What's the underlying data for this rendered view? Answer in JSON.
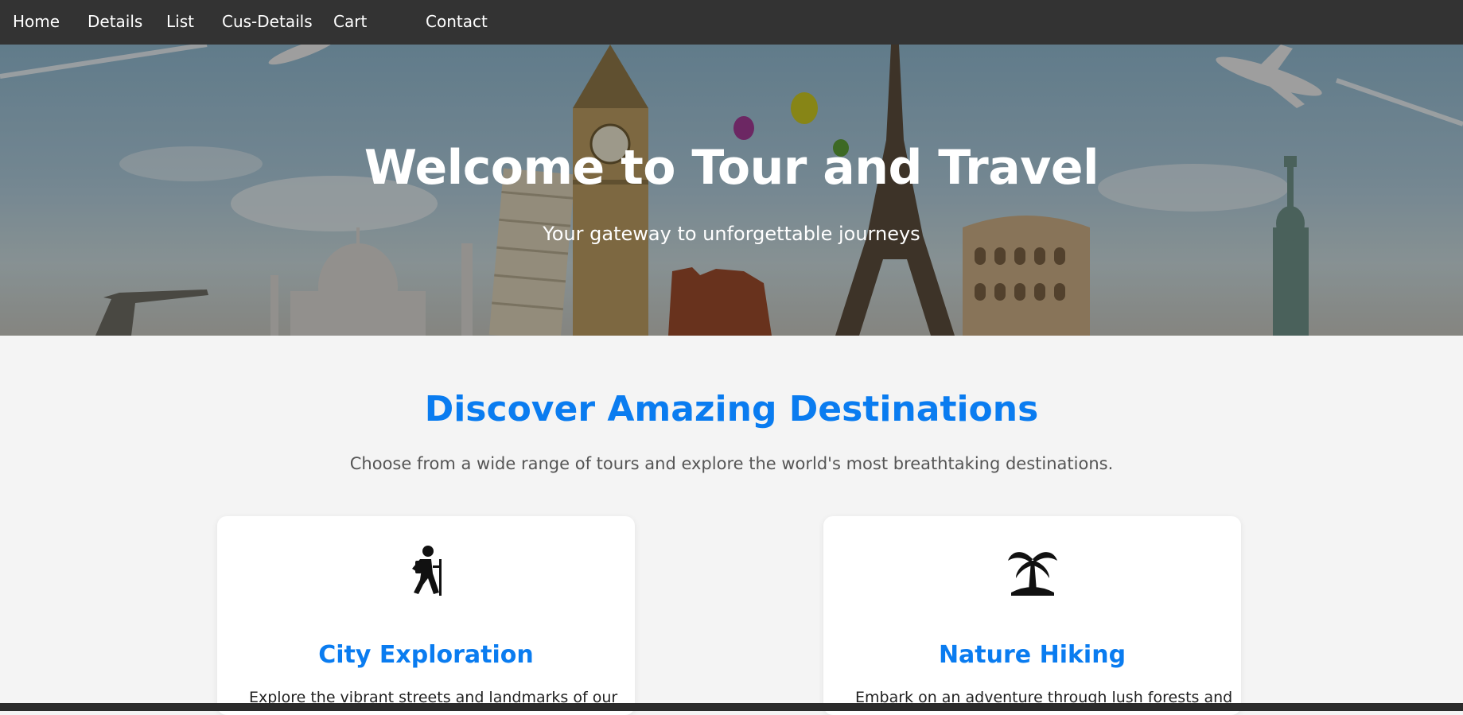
{
  "nav": {
    "items": [
      "Home",
      "Details",
      "List",
      "Cus-Details",
      "Cart",
      "Contact"
    ]
  },
  "hero": {
    "title": "Welcome to Tour and Travel",
    "subtitle": "Your gateway to unforgettable journeys"
  },
  "section": {
    "title": "Discover Amazing Destinations",
    "description": "Choose from a wide range of tours and explore the world's most breathtaking destinations."
  },
  "cards": [
    {
      "icon": "hiker-icon",
      "title": "City Exploration",
      "text": "Explore the vibrant streets and landmarks of our"
    },
    {
      "icon": "palm-tree-icon",
      "title": "Nature Hiking",
      "text": "Embark on an adventure through lush forests and"
    }
  ],
  "colors": {
    "nav_bg": "#333333",
    "accent": "#0a7cf0",
    "page_bg": "#f4f4f4"
  }
}
